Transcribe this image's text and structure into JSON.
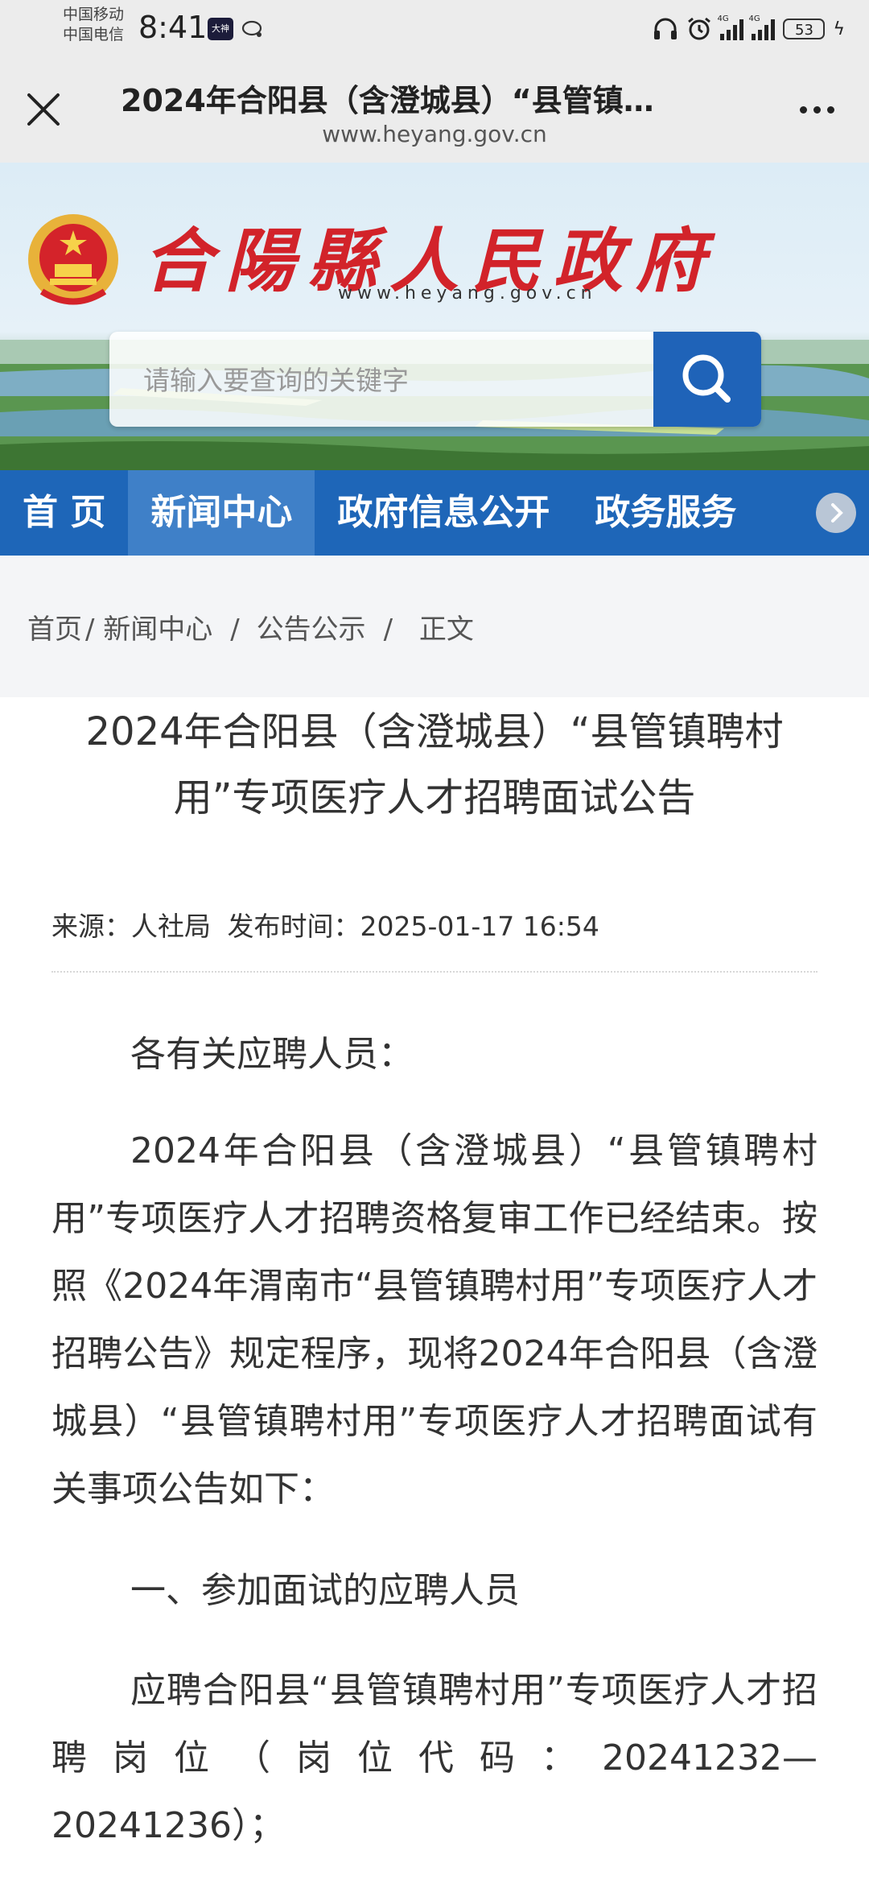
{
  "status_bar": {
    "carrier_1": "中国移动",
    "carrier_2": "中国电信",
    "time": "8:41",
    "badge_text": "大神",
    "signal_label": "4G",
    "battery": "53"
  },
  "browser": {
    "title": "2024年合阳县（含澄城县）“县管镇…",
    "url": "www.heyang.gov.cn",
    "close_icon": "close-icon",
    "more_icon": "more-icon"
  },
  "site": {
    "name": "合陽縣人民政府",
    "domain": "www.heyang.gov.cn",
    "search_placeholder": "请输入要查询的关键字"
  },
  "nav": {
    "items": [
      "首 页",
      "新闻中心",
      "政府信息公开",
      "政务服务"
    ]
  },
  "breadcrumb": {
    "items": [
      "首页",
      "新闻中心",
      "公告公示",
      "正文"
    ],
    "separator": "/"
  },
  "article": {
    "title": "2024年合阳县（含澄城县）“县管镇聘村用”专项医疗人才招聘面试公告",
    "source_label": "来源：人社局",
    "date_label": "发布时间：2025-01-17 16:54",
    "p1": "各有关应聘人员：",
    "p2": "2024年合阳县（含澄城县）“县管镇聘村用”专项医疗人才招聘资格复审工作已经结束。按照《2024年渭南市“县管镇聘村用”专项医疗人才招聘公告》规定程序，现将2024年合阳县（含澄城县）“县管镇聘村用”专项医疗人才招聘面试有关事项公告如下：",
    "p3": "一、参加面试的应聘人员",
    "p4": "应聘合阳县“县管镇聘村用”专项医疗人才招聘岗位（岗位代码：20241232—",
    "p4b": "20241236）；"
  },
  "colors": {
    "nav_blue": "#1e66b8",
    "nav_active": "#3f80c8",
    "title_red": "#d2232a"
  }
}
